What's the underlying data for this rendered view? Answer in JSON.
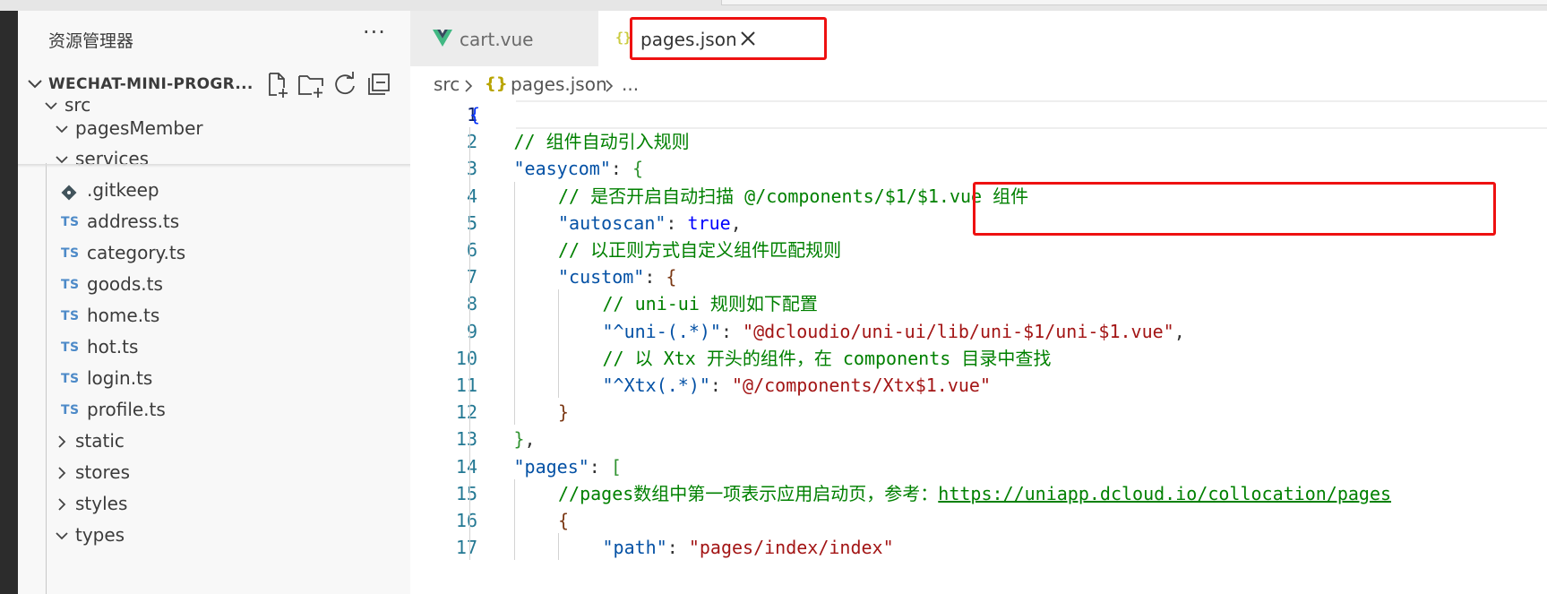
{
  "sidebar": {
    "title": "资源管理器",
    "more": "···",
    "project": "WECHAT-MINI-PROGR...",
    "tree": [
      {
        "label": "src",
        "kind": "folder-open",
        "depth": 0
      },
      {
        "label": "pagesMember",
        "kind": "folder-open",
        "depth": 1
      },
      {
        "label": "services",
        "kind": "folder-open",
        "depth": 1
      },
      {
        "label": ".gitkeep",
        "kind": "git",
        "depth": 2
      },
      {
        "label": "address.ts",
        "kind": "ts",
        "depth": 2
      },
      {
        "label": "category.ts",
        "kind": "ts",
        "depth": 2
      },
      {
        "label": "goods.ts",
        "kind": "ts",
        "depth": 2
      },
      {
        "label": "home.ts",
        "kind": "ts",
        "depth": 2
      },
      {
        "label": "hot.ts",
        "kind": "ts",
        "depth": 2
      },
      {
        "label": "login.ts",
        "kind": "ts",
        "depth": 2
      },
      {
        "label": "profile.ts",
        "kind": "ts",
        "depth": 2
      },
      {
        "label": "static",
        "kind": "folder-closed",
        "depth": 1
      },
      {
        "label": "stores",
        "kind": "folder-closed",
        "depth": 1
      },
      {
        "label": "styles",
        "kind": "folder-closed",
        "depth": 1
      },
      {
        "label": "types",
        "kind": "folder-open",
        "depth": 1
      }
    ],
    "ts_badge": "TS"
  },
  "tabs": [
    {
      "label": "cart.vue",
      "icon": "vue-icon",
      "active": false
    },
    {
      "label": "pages.json",
      "icon": "json-braces-icon",
      "active": true
    }
  ],
  "breadcrumb": {
    "folder": "src",
    "file_icon": "{}",
    "file": "pages.json",
    "ellipsis": "..."
  },
  "editor": {
    "active_line": 1,
    "line_numbers": [
      "1",
      "2",
      "3",
      "4",
      "5",
      "6",
      "7",
      "8",
      "9",
      "10",
      "11",
      "12",
      "13",
      "14",
      "15",
      "16",
      "17"
    ],
    "lines": [
      {
        "indent": 0,
        "tokens": [
          {
            "t": "{",
            "c": "brace"
          }
        ]
      },
      {
        "indent": 1,
        "tokens": [
          {
            "t": "// 组件自动引入规则",
            "c": "cmt"
          }
        ]
      },
      {
        "indent": 1,
        "tokens": [
          {
            "t": "\"easycom\"",
            "c": "key"
          },
          {
            "t": ": ",
            "c": "punc"
          },
          {
            "t": "{",
            "c": "brace2"
          }
        ]
      },
      {
        "indent": 2,
        "tokens": [
          {
            "t": "// 是否开启自动扫描 @/components/$1/$1.vue 组件",
            "c": "cmt"
          }
        ]
      },
      {
        "indent": 2,
        "tokens": [
          {
            "t": "\"autoscan\"",
            "c": "key"
          },
          {
            "t": ": ",
            "c": "punc"
          },
          {
            "t": "true",
            "c": "kw"
          },
          {
            "t": ",",
            "c": "punc"
          }
        ]
      },
      {
        "indent": 2,
        "tokens": [
          {
            "t": "// 以正则方式自定义组件匹配规则",
            "c": "cmt"
          }
        ]
      },
      {
        "indent": 2,
        "tokens": [
          {
            "t": "\"custom\"",
            "c": "key"
          },
          {
            "t": ": ",
            "c": "punc"
          },
          {
            "t": "{",
            "c": "brace3"
          }
        ]
      },
      {
        "indent": 3,
        "tokens": [
          {
            "t": "// uni-ui 规则如下配置",
            "c": "cmt"
          }
        ]
      },
      {
        "indent": 3,
        "tokens": [
          {
            "t": "\"^uni-(.*)\"",
            "c": "key"
          },
          {
            "t": ": ",
            "c": "punc"
          },
          {
            "t": "\"@dcloudio/uni-ui/lib/uni-$1/uni-$1.vue\"",
            "c": "str"
          },
          {
            "t": ",",
            "c": "punc"
          }
        ]
      },
      {
        "indent": 3,
        "tokens": [
          {
            "t": "// 以 Xtx 开头的组件，在 components 目录中查找",
            "c": "cmt"
          }
        ]
      },
      {
        "indent": 3,
        "tokens": [
          {
            "t": "\"^Xtx(.*)\"",
            "c": "key"
          },
          {
            "t": ": ",
            "c": "punc"
          },
          {
            "t": "\"@/components/Xtx$1.vue\"",
            "c": "str"
          }
        ]
      },
      {
        "indent": 2,
        "tokens": [
          {
            "t": "}",
            "c": "brace3"
          }
        ]
      },
      {
        "indent": 1,
        "tokens": [
          {
            "t": "}",
            "c": "brace2"
          },
          {
            "t": ",",
            "c": "punc"
          }
        ]
      },
      {
        "indent": 1,
        "tokens": [
          {
            "t": "\"pages\"",
            "c": "key"
          },
          {
            "t": ": ",
            "c": "punc"
          },
          {
            "t": "[",
            "c": "brace2"
          }
        ]
      },
      {
        "indent": 2,
        "tokens": [
          {
            "t": "//pages数组中第一项表示应用启动页，参考：",
            "c": "cmt"
          },
          {
            "t": "https://uniapp.dcloud.io/collocation/pages",
            "c": "link"
          }
        ]
      },
      {
        "indent": 2,
        "tokens": [
          {
            "t": "{",
            "c": "brace3"
          }
        ]
      },
      {
        "indent": 3,
        "tokens": [
          {
            "t": "\"path\"",
            "c": "key"
          },
          {
            "t": ": ",
            "c": "punc"
          },
          {
            "t": "\"pages/index/index\"",
            "c": "str"
          }
        ]
      }
    ]
  },
  "colors": {
    "highlight_box": "#ee1111",
    "ts_badge": "#4d8ac8",
    "vue_green": "#41b883",
    "json_yellow": "#cbcb41",
    "line_number": "#237893"
  }
}
